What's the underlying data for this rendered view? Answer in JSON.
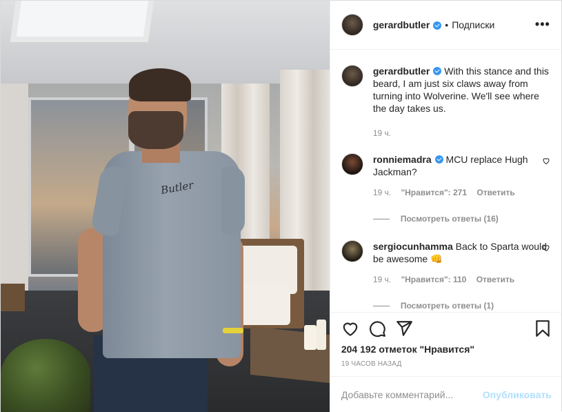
{
  "header": {
    "username": "gerardbutler",
    "separator": "•",
    "follow_label": "Подписки",
    "more_label": "•••"
  },
  "photo": {
    "shirt_logo": "Butler"
  },
  "caption": {
    "username": "gerardbutler",
    "text": "With this stance and this beard, I am just six claws away from turning into Wolverine. We'll see where the day takes us.",
    "time": "19 ч."
  },
  "comments": [
    {
      "username": "ronniemadra",
      "verified": true,
      "text": "MCU replace Hugh Jackman?",
      "time": "19 ч.",
      "likes": "\"Нравится\": 271",
      "reply_label": "Ответить",
      "view_replies": "Посмотреть ответы (16)"
    },
    {
      "username": "sergiocunhamma",
      "verified": false,
      "text": "Back to Sparta would be awesome 👊",
      "time": "19 ч.",
      "likes": "\"Нравится\": 110",
      "reply_label": "Ответить",
      "view_replies": "Посмотреть ответы (1)"
    }
  ],
  "actions": {
    "icons": [
      "heart-icon",
      "comment-icon",
      "share-icon",
      "bookmark-icon"
    ]
  },
  "likes_text": "204 192 отметок \"Нравится\"",
  "post_time": "19 ЧАСОВ НАЗАД",
  "add_comment": {
    "placeholder": "Добавьте комментарий...",
    "publish_label": "Опубликовать"
  },
  "colors": {
    "verified": "#3897f0",
    "publish_disabled": "#b2dffc",
    "meta": "#8e8e8e"
  }
}
